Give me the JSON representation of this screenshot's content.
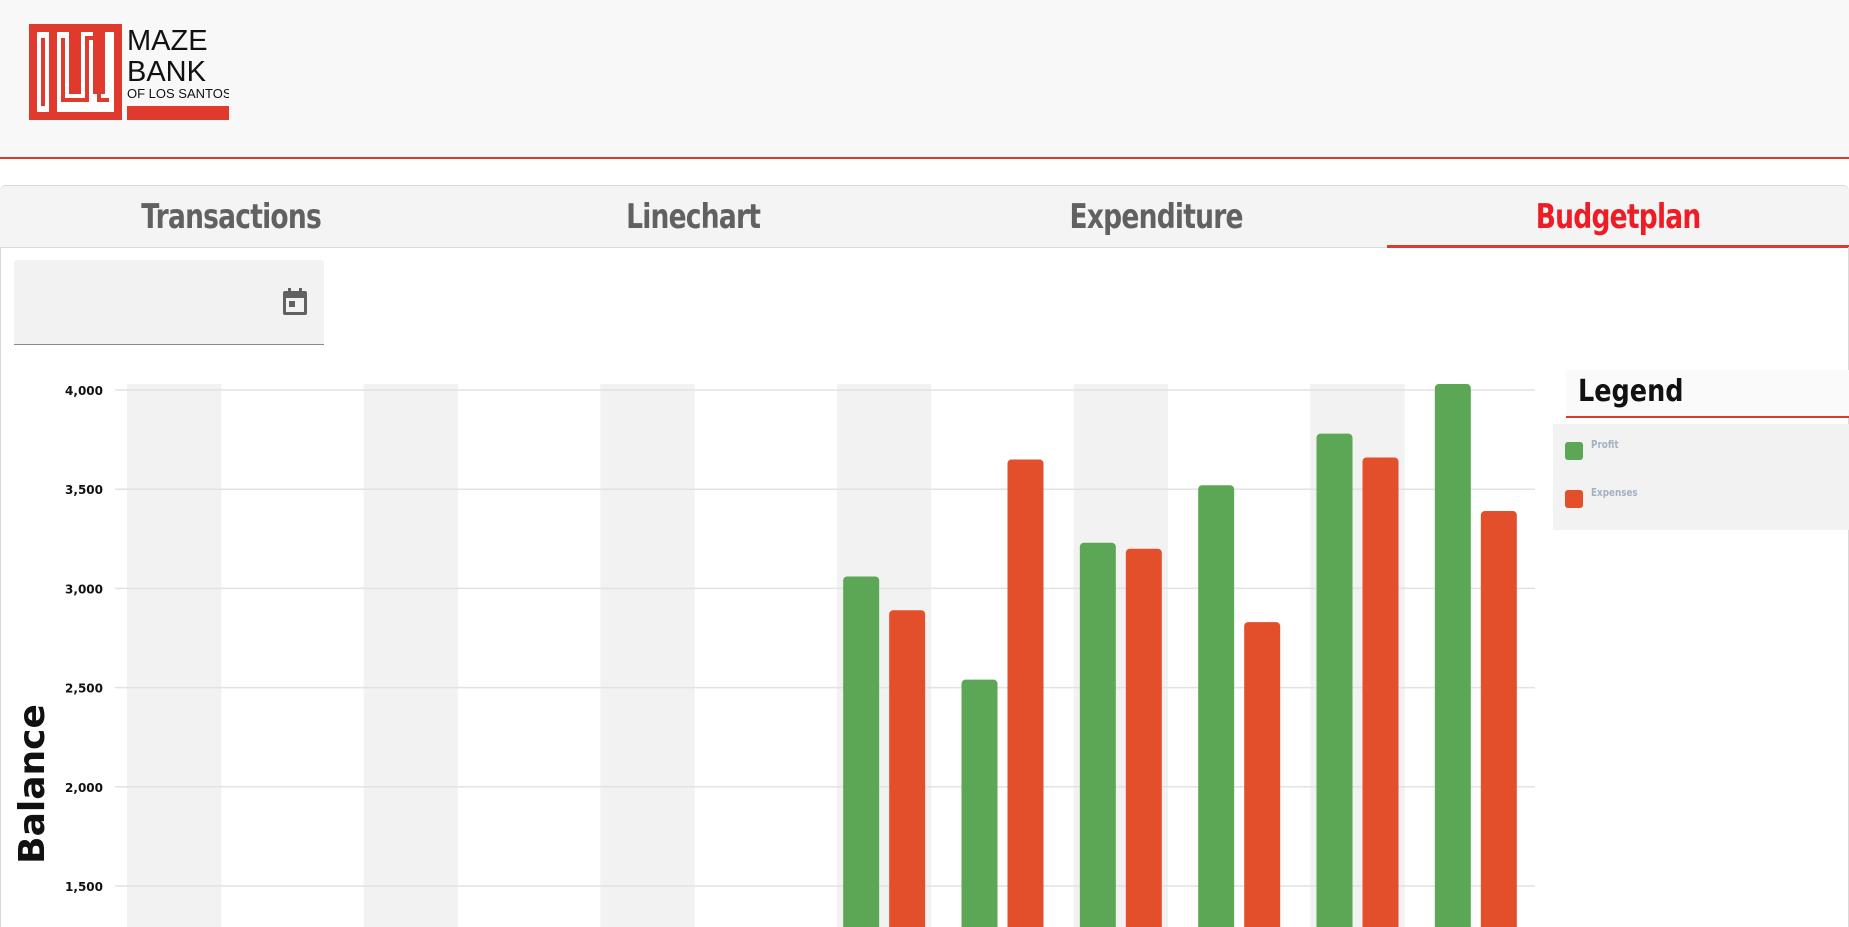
{
  "tabs": [
    {
      "label": "Transactions",
      "active": false
    },
    {
      "label": "Linechart",
      "active": false
    },
    {
      "label": "Expenditure",
      "active": false
    },
    {
      "label": "Budgetplan",
      "active": true
    }
  ],
  "logo": {
    "line1": "MAZE",
    "line2": "BANK",
    "line3": "OF LOS SANTOS",
    "brand_color": "#e03a2f"
  },
  "date_field": {
    "value": "",
    "icon": "calendar-icon"
  },
  "legend": {
    "title": "Legend",
    "items": [
      {
        "label": "Profit",
        "color": "#5ba755"
      },
      {
        "label": "Expenses",
        "color": "#e34f2b"
      }
    ]
  },
  "chart_data": {
    "type": "bar",
    "ylabel": "Balance",
    "ylim": [
      1300,
      4050
    ],
    "yticks": [
      1500,
      2000,
      2500,
      3000,
      3500,
      4000
    ],
    "ytick_labels": [
      "1,500",
      "2,000",
      "2,500",
      "3,000",
      "3,500",
      "4,000"
    ],
    "grid": true,
    "categories": [
      "",
      "",
      "",
      "",
      "",
      "",
      "",
      "",
      "",
      "",
      "",
      ""
    ],
    "series": [
      {
        "name": "Profit",
        "color": "#5ba755",
        "values": [
          null,
          null,
          null,
          null,
          null,
          null,
          3060,
          2540,
          3230,
          3520,
          3780,
          4030
        ]
      },
      {
        "name": "Expenses",
        "color": "#e34f2b",
        "values": [
          null,
          null,
          null,
          null,
          null,
          null,
          2890,
          3650,
          3200,
          2830,
          3660,
          3390
        ]
      }
    ]
  }
}
